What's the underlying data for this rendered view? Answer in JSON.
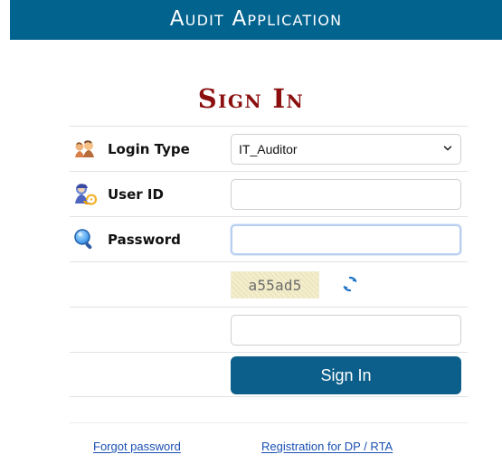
{
  "header": {
    "title": "Audit Application"
  },
  "signin": {
    "title": "Sign In"
  },
  "form": {
    "login_type": {
      "label": "Login Type",
      "value": "IT_Auditor",
      "icon": "users-icon"
    },
    "user_id": {
      "label": "User ID",
      "value": "",
      "icon": "user-key-icon"
    },
    "password": {
      "label": "Password",
      "value": "",
      "icon": "search-icon"
    },
    "captcha": {
      "code": "a55ad5",
      "refresh_icon": "refresh-icon"
    },
    "captcha_input": {
      "value": ""
    },
    "submit": {
      "label": "Sign In"
    }
  },
  "footer": {
    "forgot_password": "Forgot password",
    "registration": "Registration for DP / RTA"
  },
  "colors": {
    "primary": "#0b5f8a",
    "title_red": "#8b0f0f",
    "link_blue": "#1a4fb3"
  }
}
